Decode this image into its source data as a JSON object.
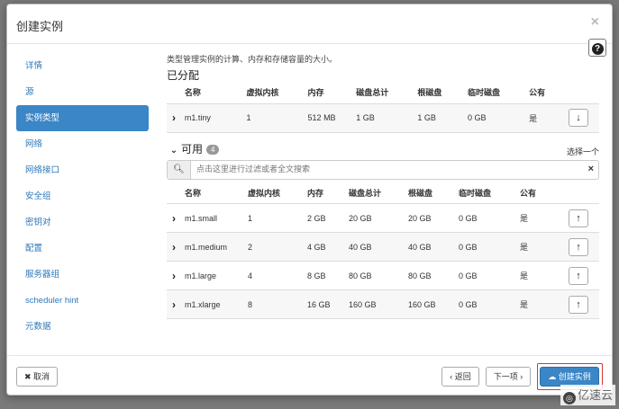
{
  "modal": {
    "title": "创建实例",
    "close": "×",
    "help": "?"
  },
  "sidebar": {
    "items": [
      {
        "label": "详情"
      },
      {
        "label": "源"
      },
      {
        "label": "实例类型",
        "active": true
      },
      {
        "label": "网络"
      },
      {
        "label": "网络接口"
      },
      {
        "label": "安全组"
      },
      {
        "label": "密钥对"
      },
      {
        "label": "配置"
      },
      {
        "label": "服务器组"
      },
      {
        "label": "scheduler hint"
      },
      {
        "label": "元数据"
      }
    ]
  },
  "main": {
    "description": "类型管理实例的计算、内存和存储容量的大小。",
    "allocated_title": "已分配",
    "columns": [
      "名称",
      "虚拟内核",
      "内存",
      "磁盘总计",
      "根磁盘",
      "临时磁盘",
      "公有"
    ],
    "allocated": [
      {
        "name": "m1.tiny",
        "vcpus": "1",
        "ram": "512 MB",
        "total_disk": "1 GB",
        "root_disk": "1 GB",
        "ephemeral": "0 GB",
        "public": "是"
      }
    ],
    "available_title": "可用",
    "available_count": "4",
    "select_one": "选择一个",
    "search_placeholder": "点击这里进行过滤或者全文搜索",
    "available": [
      {
        "name": "m1.small",
        "vcpus": "1",
        "ram": "2 GB",
        "total_disk": "20 GB",
        "root_disk": "20 GB",
        "ephemeral": "0 GB",
        "public": "是"
      },
      {
        "name": "m1.medium",
        "vcpus": "2",
        "ram": "4 GB",
        "total_disk": "40 GB",
        "root_disk": "40 GB",
        "ephemeral": "0 GB",
        "public": "是"
      },
      {
        "name": "m1.large",
        "vcpus": "4",
        "ram": "8 GB",
        "total_disk": "80 GB",
        "root_disk": "80 GB",
        "ephemeral": "0 GB",
        "public": "是"
      },
      {
        "name": "m1.xlarge",
        "vcpus": "8",
        "ram": "16 GB",
        "total_disk": "160 GB",
        "root_disk": "160 GB",
        "ephemeral": "0 GB",
        "public": "是"
      }
    ]
  },
  "footer": {
    "cancel": "取消",
    "back": "返回",
    "next": "下一项",
    "launch": "创建实例"
  },
  "watermark": "亿速云",
  "colors": {
    "primary": "#3b86c6",
    "link": "#2e77b8",
    "highlight": "#dd3333"
  }
}
